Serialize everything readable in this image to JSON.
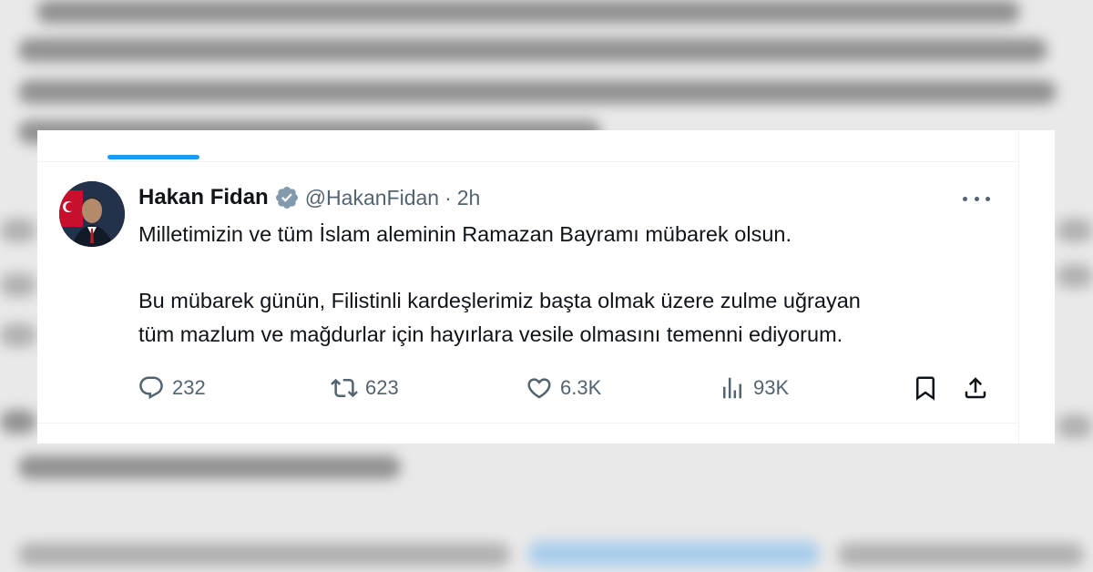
{
  "tweet": {
    "author_name": "Hakan Fidan",
    "handle": "@HakanFidan",
    "separator": "·",
    "time": "2h",
    "text_line1": "Milletimizin ve tüm İslam aleminin Ramazan Bayramı mübarek olsun.",
    "text_line2": "Bu mübarek günün, Filistinli kardeşlerimiz başta olmak üzere zulme uğrayan",
    "text_line3": "tüm mazlum ve mağdurlar için hayırlara vesile olmasını temenni ediyorum."
  },
  "actions": {
    "replies": "232",
    "reposts": "623",
    "likes": "6.3K",
    "views": "93K"
  },
  "icons": {
    "reply": "reply-icon",
    "repost": "repost-icon",
    "like": "heart-icon",
    "views": "views-icon",
    "bookmark": "bookmark-icon",
    "share": "share-icon",
    "verified": "verified-badge-icon",
    "more": "more-icon"
  },
  "colors": {
    "accent": "#1d9bf0",
    "muted": "#536471",
    "text": "#0f1419",
    "verified_badge": "#829aab"
  }
}
